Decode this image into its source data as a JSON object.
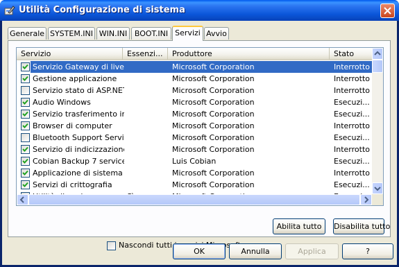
{
  "window": {
    "title": "Utilità Configurazione di sistema",
    "title_icon": "system-config-icon",
    "close_icon": "close-icon"
  },
  "tabs": [
    {
      "label": "Generale"
    },
    {
      "label": "SYSTEM.INI"
    },
    {
      "label": "WIN.INI"
    },
    {
      "label": "BOOT.INI"
    },
    {
      "label": "Servizi",
      "active": true
    },
    {
      "label": "Avvio"
    }
  ],
  "columns": {
    "service": "Servizio",
    "essential": "Essenzi...",
    "vendor": "Produttore",
    "status": "Stato"
  },
  "rows": [
    {
      "checked": true,
      "name": "Servizio Gateway di livell...",
      "essential": "",
      "vendor": "Microsoft Corporation",
      "status": "Interrotto",
      "selected": true
    },
    {
      "checked": true,
      "name": "Gestione applicazione",
      "essential": "",
      "vendor": "Microsoft Corporation",
      "status": "Interrotto"
    },
    {
      "checked": false,
      "name": "Servizio stato di ASP.NET",
      "essential": "",
      "vendor": "Microsoft Corporation",
      "status": "Interrotto"
    },
    {
      "checked": true,
      "name": "Audio Windows",
      "essential": "",
      "vendor": "Microsoft Corporation",
      "status": "Esecuzi..."
    },
    {
      "checked": true,
      "name": "Servizio trasferimento in...",
      "essential": "",
      "vendor": "Microsoft Corporation",
      "status": "Esecuzi..."
    },
    {
      "checked": true,
      "name": "Browser di computer",
      "essential": "",
      "vendor": "Microsoft Corporation",
      "status": "Interrotto"
    },
    {
      "checked": false,
      "name": "Bluetooth Support Service",
      "essential": "",
      "vendor": "Microsoft Corporation",
      "status": "Esecuzi..."
    },
    {
      "checked": true,
      "name": "Servizio di indicizzazione",
      "essential": "",
      "vendor": "Microsoft Corporation",
      "status": "Interrotto"
    },
    {
      "checked": true,
      "name": "Cobian Backup 7 service",
      "essential": "",
      "vendor": "Luis Cobian",
      "status": "Esecuzi..."
    },
    {
      "checked": true,
      "name": "Applicazione di sistema C...",
      "essential": "",
      "vendor": "Microsoft Corporation",
      "status": "Interrotto"
    },
    {
      "checked": true,
      "name": "Servizi di crittografia",
      "essential": "",
      "vendor": "Microsoft Corporation",
      "status": "Esecuzi..."
    },
    {
      "checked": true,
      "name": "Utilità di avvio processo ...",
      "essential": "Sì",
      "vendor": "Microsoft Corporation",
      "status": "Esecuzi..."
    }
  ],
  "options": {
    "hide_ms_label": "Nascondi tutti i servizi Microsoft",
    "hide_ms_checked": false
  },
  "buttons": {
    "enable_all": "Abilita tutto",
    "disable_all": "Disabilita tutto",
    "ok": "OK",
    "cancel": "Annulla",
    "apply": "Applica",
    "help": "?"
  },
  "colors": {
    "titlebar": "#0a55d8",
    "selection": "#316ac5",
    "dialog_bg": "#ece9d8",
    "active_tab_accent": "#ffc83c"
  }
}
